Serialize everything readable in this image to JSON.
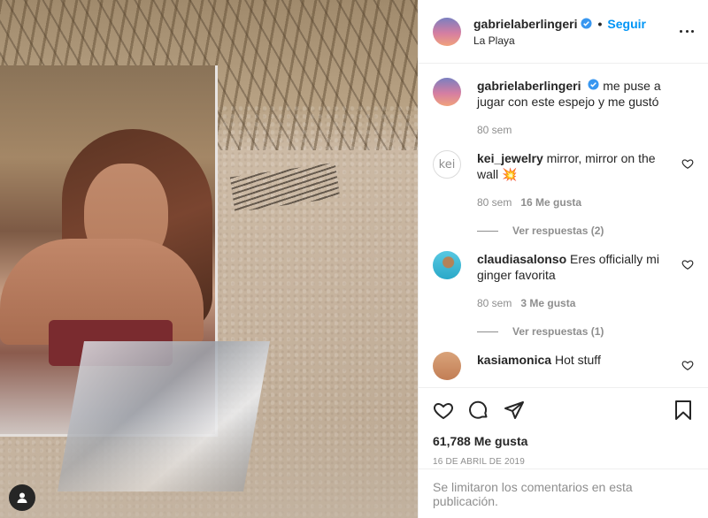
{
  "post": {
    "username": "gabrielaberlingeri",
    "follow_label": "Seguir",
    "separator": "•",
    "location": "La Playa",
    "caption": "me puse a jugar con este espejo y me gustó",
    "caption_time": "80 sem"
  },
  "comments": [
    {
      "username": "kei_jewelry",
      "text": "mirror, mirror on the wall",
      "emoji": "💥",
      "avatar_text": "kei",
      "time": "80 sem",
      "likes": "16 Me gusta",
      "replies": "Ver respuestas (2)"
    },
    {
      "username": "claudiasalonso",
      "text": "Eres officially mi ginger favorita",
      "time": "80 sem",
      "likes": "3 Me gusta",
      "replies": "Ver respuestas (1)"
    },
    {
      "username": "kasiamonica",
      "text": "Hot stuff"
    }
  ],
  "footer": {
    "likes_count": "61,788 Me gusta",
    "date": "16 DE ABRIL DE 2019",
    "comments_limited": "Se limitaron los comentarios en esta publicación."
  },
  "icons": {
    "verified": "verified-badge-icon",
    "more": "more-options-icon",
    "like": "heart-icon",
    "comment": "comment-icon",
    "share": "share-icon",
    "save": "bookmark-icon",
    "user_tag": "user-tag-icon"
  },
  "colors": {
    "accent": "#0095f6",
    "muted": "#8e8e8e",
    "text": "#262626"
  }
}
